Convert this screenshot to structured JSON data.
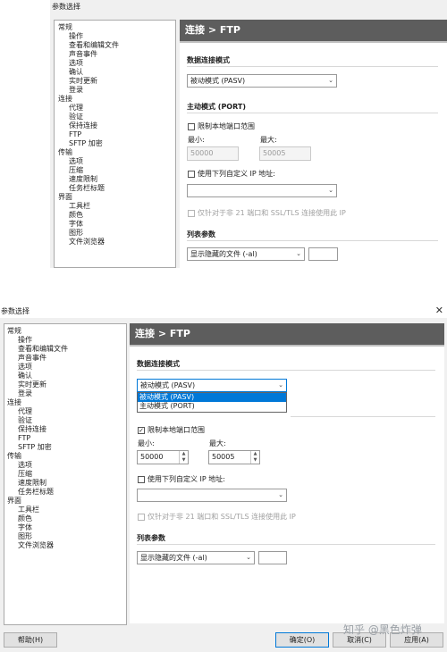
{
  "dialog_title": "参数选择",
  "tree_items": [
    {
      "label": "常规"
    },
    {
      "label": "操作"
    },
    {
      "label": "查看和编辑文件"
    },
    {
      "label": "声音事件"
    },
    {
      "label": "选项"
    },
    {
      "label": "确认"
    },
    {
      "label": "实时更新"
    },
    {
      "label": "登录"
    },
    {
      "label": "连接"
    },
    {
      "label": "代理"
    },
    {
      "label": "验证"
    },
    {
      "label": "保持连接"
    },
    {
      "label": "FTP"
    },
    {
      "label": "SFTP 加密"
    },
    {
      "label": "传输"
    },
    {
      "label": "选项"
    },
    {
      "label": "压缩"
    },
    {
      "label": "速度限制"
    },
    {
      "label": "任务栏标题"
    },
    {
      "label": "界面"
    },
    {
      "label": "工具栏"
    },
    {
      "label": "颜色"
    },
    {
      "label": "字体"
    },
    {
      "label": "图形"
    },
    {
      "label": "文件浏览器"
    }
  ],
  "page_header": "连接 > FTP",
  "data_conn_section": "数据连接模式",
  "mode_value": "被动模式 (PASV)",
  "mode_options": [
    "被动模式 (PASV)",
    "主动模式 (PORT)"
  ],
  "active_section": "主动模式 (PORT)",
  "port_range_label": "限制本地端口范围",
  "min_label": "最小:",
  "max_label": "最大:",
  "top": {
    "min_value": "50000",
    "max_value": "50005"
  },
  "bottom": {
    "min_value": "50000",
    "max_value": "50005"
  },
  "custom_ip_label": "使用下列自定义 IP 地址:",
  "ip_only_label": "仅针对于非 21 端口和 SSL/TLS 连接使用此 IP",
  "list_section": "列表参数",
  "list_value": "显示隐藏的文件 (-al)",
  "buttons": {
    "help": "帮助(H)",
    "ok": "确定(O)",
    "cancel": "取消(C)",
    "apply": "应用(A)"
  },
  "watermark": "知乎 @黑色炸弹",
  "colors": {
    "header_bg": "#5d5d5d",
    "accent": "#f0a030",
    "selection": "#0078d7"
  }
}
